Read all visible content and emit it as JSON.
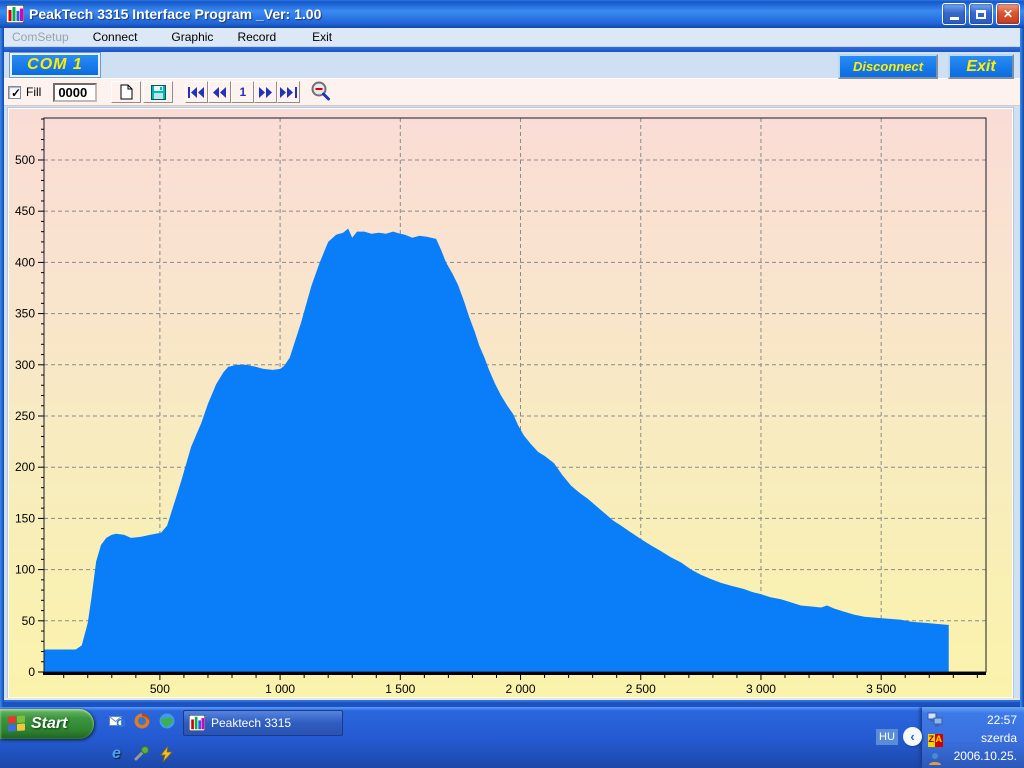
{
  "window": {
    "title": "PeakTech 3315 Interface Program _Ver: 1.00"
  },
  "menu": {
    "items": [
      {
        "label": "ComSetup",
        "enabled": false
      },
      {
        "label": "Connect",
        "enabled": true
      },
      {
        "label": "Graphic",
        "enabled": true
      },
      {
        "label": "Record",
        "enabled": true
      },
      {
        "label": "Exit",
        "enabled": true
      }
    ]
  },
  "connection": {
    "port_label": "COM 1",
    "disconnect_label": "Disconnect",
    "exit_label": "Exit"
  },
  "toolbar": {
    "fill_label": "Fill",
    "fill_checked": true,
    "record_counter": "0000",
    "page_number": "1"
  },
  "icons": {
    "app": "bar-chart",
    "new_record": "blank-page",
    "save": "floppy-disk",
    "first": "skip-to-start",
    "previous": "rewind",
    "next": "fast-forward",
    "last": "skip-to-end",
    "zoom_out": "magnifier-minus"
  },
  "chart_data": {
    "type": "area",
    "title": "",
    "xlabel": "",
    "ylabel": "",
    "xlim": [
      18,
      3936
    ],
    "ylim": [
      0,
      541
    ],
    "x_ticks": [
      500,
      1000,
      1500,
      2000,
      2500,
      3000,
      3500
    ],
    "x_tick_labels": [
      "500",
      "1 000",
      "1 500",
      "2 000",
      "2 500",
      "3 000",
      "3 500"
    ],
    "y_ticks": [
      0,
      50,
      100,
      150,
      200,
      250,
      300,
      350,
      400,
      450,
      500
    ],
    "x_minor_step": 100,
    "y_minor_step": 10,
    "grid": "dashed",
    "grid_color": "#8a8a8a",
    "area_color": "#0a7ef8",
    "background_gradient": [
      "#fadcd6",
      "#faf3ab"
    ],
    "points": [
      [
        18,
        22
      ],
      [
        100,
        22
      ],
      [
        150,
        22
      ],
      [
        175,
        26
      ],
      [
        200,
        48
      ],
      [
        215,
        72
      ],
      [
        235,
        108
      ],
      [
        255,
        124
      ],
      [
        277,
        131
      ],
      [
        300,
        134
      ],
      [
        318,
        135
      ],
      [
        350,
        134
      ],
      [
        380,
        131
      ],
      [
        420,
        132
      ],
      [
        460,
        134
      ],
      [
        505,
        136
      ],
      [
        530,
        143
      ],
      [
        560,
        165
      ],
      [
        588,
        186
      ],
      [
        630,
        220
      ],
      [
        672,
        243
      ],
      [
        700,
        262
      ],
      [
        734,
        281
      ],
      [
        765,
        293
      ],
      [
        784,
        298
      ],
      [
        820,
        300
      ],
      [
        859,
        300
      ],
      [
        900,
        298
      ],
      [
        930,
        296
      ],
      [
        970,
        295
      ],
      [
        1000,
        296
      ],
      [
        1017,
        299
      ],
      [
        1040,
        307
      ],
      [
        1087,
        341
      ],
      [
        1130,
        377
      ],
      [
        1165,
        400
      ],
      [
        1200,
        420
      ],
      [
        1233,
        427
      ],
      [
        1262,
        429
      ],
      [
        1283,
        433
      ],
      [
        1300,
        424
      ],
      [
        1320,
        430
      ],
      [
        1350,
        430
      ],
      [
        1380,
        428
      ],
      [
        1410,
        429
      ],
      [
        1440,
        428
      ],
      [
        1470,
        430
      ],
      [
        1500,
        428
      ],
      [
        1520,
        427
      ],
      [
        1550,
        424
      ],
      [
        1580,
        426
      ],
      [
        1610,
        425
      ],
      [
        1649,
        423
      ],
      [
        1670,
        412
      ],
      [
        1690,
        400
      ],
      [
        1717,
        389
      ],
      [
        1740,
        378
      ],
      [
        1765,
        362
      ],
      [
        1786,
        347
      ],
      [
        1810,
        332
      ],
      [
        1828,
        319
      ],
      [
        1850,
        307
      ],
      [
        1869,
        295
      ],
      [
        1895,
        281
      ],
      [
        1919,
        270
      ],
      [
        1945,
        260
      ],
      [
        1969,
        252
      ],
      [
        1990,
        241
      ],
      [
        2014,
        231
      ],
      [
        2045,
        222
      ],
      [
        2073,
        215
      ],
      [
        2100,
        211
      ],
      [
        2139,
        204
      ],
      [
        2175,
        192
      ],
      [
        2210,
        182
      ],
      [
        2245,
        175
      ],
      [
        2281,
        169
      ],
      [
        2320,
        161
      ],
      [
        2355,
        154
      ],
      [
        2385,
        148
      ],
      [
        2418,
        143
      ],
      [
        2455,
        137
      ],
      [
        2493,
        131
      ],
      [
        2540,
        124
      ],
      [
        2584,
        118
      ],
      [
        2625,
        112
      ],
      [
        2667,
        107
      ],
      [
        2710,
        100
      ],
      [
        2750,
        95
      ],
      [
        2790,
        91
      ],
      [
        2834,
        87
      ],
      [
        2880,
        84
      ],
      [
        2929,
        81
      ],
      [
        2965,
        78
      ],
      [
        3000,
        76
      ],
      [
        3040,
        73
      ],
      [
        3083,
        71
      ],
      [
        3125,
        68
      ],
      [
        3166,
        65
      ],
      [
        3210,
        64
      ],
      [
        3250,
        63
      ],
      [
        3275,
        65
      ],
      [
        3304,
        62
      ],
      [
        3345,
        59
      ],
      [
        3387,
        56
      ],
      [
        3430,
        54
      ],
      [
        3478,
        53
      ],
      [
        3530,
        52
      ],
      [
        3582,
        51
      ],
      [
        3630,
        49
      ],
      [
        3686,
        48
      ],
      [
        3730,
        47
      ],
      [
        3777,
        46
      ],
      [
        3781,
        46
      ]
    ]
  },
  "taskbar": {
    "start_label": "Start",
    "task_button_label": "Peaktech 3315",
    "tray": {
      "language": "HU",
      "time": "22:57",
      "day": "szerda",
      "date": "2006.10.25."
    }
  }
}
